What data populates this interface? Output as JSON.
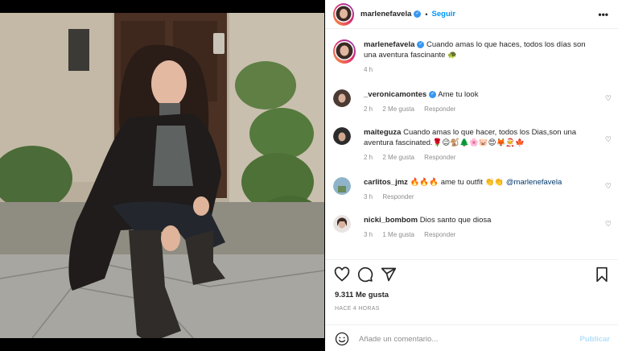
{
  "post": {
    "username": "marlenefavela",
    "follow_label": "Seguir",
    "caption_user": "marlenefavela",
    "caption": "Cuando amas lo que haces, todos los días son una aventura fascinante 🐢",
    "caption_time": "4 h"
  },
  "comments": [
    {
      "user": "_veronicamontes",
      "verified": true,
      "text": "Ame tu look",
      "time": "2 h",
      "likes": "2 Me gusta",
      "reply": "Responder"
    },
    {
      "user": "maiteguza",
      "verified": false,
      "text": "Cuando amas lo que hacer, todos los Dias,son una aventura fascinated.🌹😉🐒🌲🌸🐷😍🦊🧑‍🎄🍁",
      "time": "2 h",
      "likes": "2 Me gusta",
      "reply": "Responder"
    },
    {
      "user": "carlitos_jmz",
      "verified": false,
      "text": "🔥🔥🔥 ame tu outfit 👏👏 ",
      "mention": "@marlenefavela",
      "time": "3 h",
      "likes": "",
      "reply": "Responder"
    },
    {
      "user": "nicki_bombom",
      "verified": false,
      "text": "Dios santo que diosa",
      "time": "3 h",
      "likes": "1 Me gusta",
      "reply": "Responder"
    }
  ],
  "stats": {
    "likes": "9.311 Me gusta",
    "posted": "HACE 4 HORAS"
  },
  "composer": {
    "placeholder": "Añade un comentario...",
    "publish_label": "Publicar"
  },
  "icons": [
    "heart-icon",
    "comment-icon",
    "share-icon",
    "bookmark-icon",
    "emoji-icon",
    "more-options-icon",
    "verified-badge-icon"
  ]
}
